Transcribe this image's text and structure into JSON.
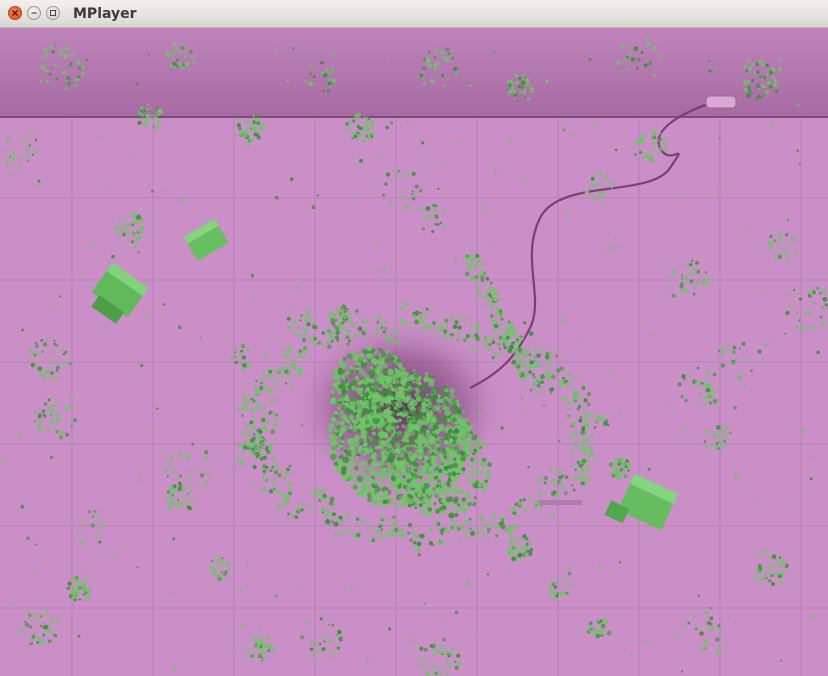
{
  "window": {
    "title": "MPlayer",
    "buttons": {
      "close": "close-icon",
      "minimize": "minimize-icon",
      "maximize": "maximize-icon"
    }
  },
  "video": {
    "description_colors": {
      "floor": "#c98fc6",
      "wall": "#b97bb4",
      "grid": "#9f6a9c",
      "debris": "#6fc468",
      "debris_dark": "#3f8f3c",
      "cable": "#7a3f73"
    }
  }
}
